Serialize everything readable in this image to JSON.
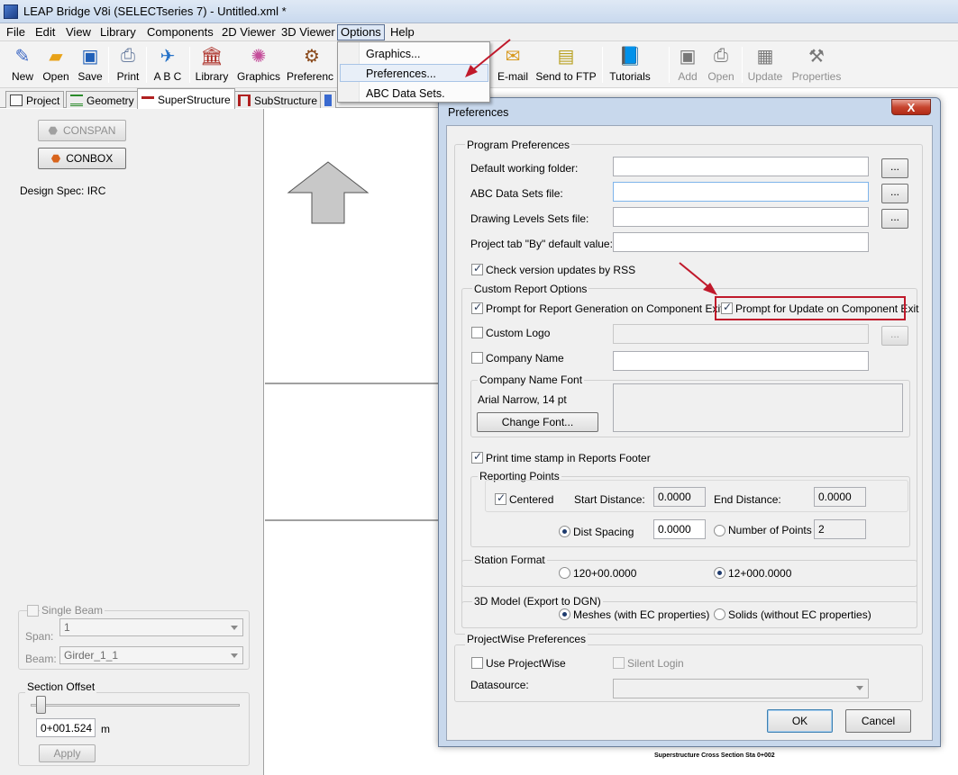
{
  "window": {
    "title": "LEAP Bridge V8i (SELECTseries 7) - Untitled.xml *"
  },
  "menubar": [
    "File",
    "Edit",
    "View",
    "Library",
    "Components",
    "2D Viewer",
    "3D Viewer",
    "Options",
    "Help"
  ],
  "options_menu": {
    "items": [
      "Graphics...",
      "Preferences...",
      "ABC Data Sets."
    ],
    "highlighted": "Preferences..."
  },
  "toolbar": {
    "new": "New",
    "open": "Open",
    "save": "Save",
    "print": "Print",
    "abc": "A B C",
    "library": "Library",
    "graphics": "Graphics",
    "preferences": "Preferenc",
    "email": "E-mail",
    "ftp": "Send to FTP",
    "tutorials": "Tutorials",
    "add": "Add",
    "open2": "Open",
    "update": "Update",
    "properties": "Properties"
  },
  "tabs": [
    "Project",
    "Geometry",
    "SuperStructure",
    "SubStructure"
  ],
  "left_panel": {
    "conspan": "CONSPAN",
    "conbox": "CONBOX",
    "design_spec": "Design Spec: IRC",
    "single_beam": "Single Beam",
    "span_label": "Span:",
    "span_value": "1",
    "beam_label": "Beam:",
    "beam_value": "Girder_1_1",
    "section_offset": "Section Offset",
    "offset_value": "0+001.524",
    "unit": "m",
    "apply": "Apply"
  },
  "dialog": {
    "title": "Preferences",
    "close": "X",
    "program_prefs": "Program Preferences",
    "default_folder": "Default working folder:",
    "abc_file": "ABC Data Sets file:",
    "drawing_levels": "Drawing Levels Sets file:",
    "by_default": "Project tab \"By\" default value:",
    "browse": "...",
    "check_rss": "Check version updates by RSS",
    "custom_report": "Custom Report Options",
    "prompt_report": "Prompt for Report Generation on Component Exit",
    "prompt_update": "Prompt for Update on Component Exit",
    "custom_logo": "Custom Logo",
    "company_name": "Company Name",
    "company_font": "Company Name Font",
    "font_value": "Arial Narrow, 14 pt",
    "change_font": "Change Font...",
    "time_stamp": "Print time stamp in Reports Footer",
    "reporting_points": "Reporting Points",
    "centered": "Centered",
    "start_distance": "Start Distance:",
    "start_value": "0.0000",
    "end_distance": "End Distance:",
    "end_value": "0.0000",
    "dist_spacing": "Dist Spacing",
    "spacing_value": "0.0000",
    "num_points": "Number of Points",
    "num_points_value": "2",
    "station_format": "Station Format",
    "station_opt1": "120+00.0000",
    "station_opt2": "12+000.0000",
    "model_3d": "3D Model (Export to DGN)",
    "meshes": "Meshes (with EC properties)",
    "solids": "Solids (without EC properties)",
    "projectwise": "ProjectWise Preferences",
    "use_pw": "Use ProjectWise",
    "silent_login": "Silent Login",
    "datasource": "Datasource:",
    "ok": "OK",
    "cancel": "Cancel"
  },
  "caption": "Superstructure Cross Section Sta 0+002"
}
